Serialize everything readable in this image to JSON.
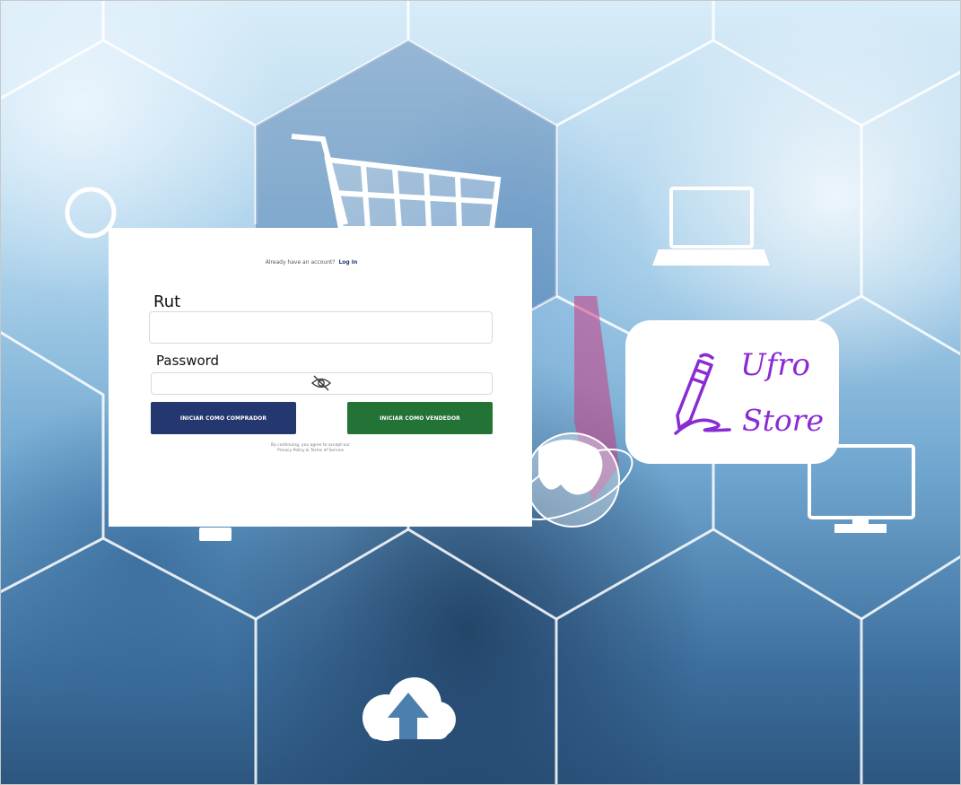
{
  "login": {
    "already_text": "Already have an account?",
    "login_link": "Log In",
    "rut_label": "Rut",
    "rut_value": "",
    "password_label": "Password",
    "password_value": "",
    "buyer_button": "INICIAR COMO COMPRADOR",
    "seller_button": "INICIAR COMO VENDEDOR",
    "terms_line1": "By continuing, you agree to accept our",
    "terms_line2": "Privacy Policy & Terms of Service"
  },
  "logo": {
    "line1": "Ufro",
    "line2": "Store"
  },
  "colors": {
    "buyer_button": "#24376f",
    "seller_button": "#237236",
    "logo_purple": "#8a2bd4"
  },
  "icons": [
    "shopping-cart-icon",
    "laptop-icon",
    "monitor-icon",
    "globe-icon",
    "cloud-upload-icon",
    "eye-slash-icon",
    "pencil-icon"
  ]
}
